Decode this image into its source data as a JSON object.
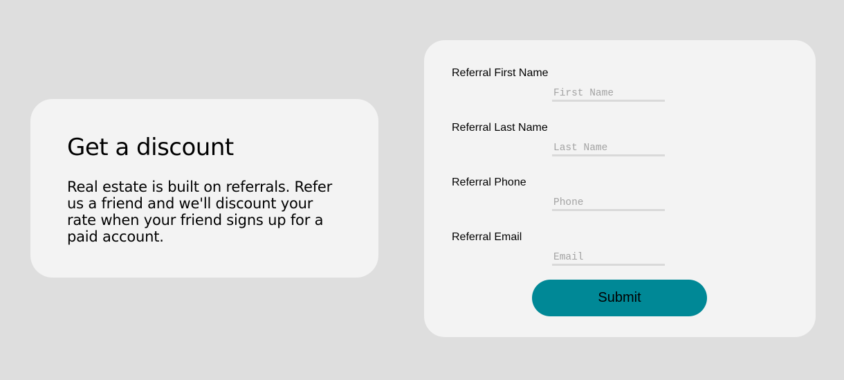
{
  "info": {
    "title": "Get a discount",
    "body": "Real estate is built on referrals. Refer us a friend and we'll discount your rate when your friend signs up for a paid account."
  },
  "form": {
    "first_name": {
      "label": "Referral First Name",
      "placeholder": "First Name",
      "value": ""
    },
    "last_name": {
      "label": "Referral Last Name",
      "placeholder": "Last Name",
      "value": ""
    },
    "phone": {
      "label": "Referral Phone",
      "placeholder": "Phone",
      "value": ""
    },
    "email": {
      "label": "Referral Email",
      "placeholder": "Email",
      "value": ""
    },
    "submit_label": "Submit"
  },
  "colors": {
    "page_background": "#dedede",
    "card_background": "#f3f3f3",
    "accent": "#008896",
    "input_underline": "#d9d9d9",
    "placeholder_text": "#a3a3a3"
  }
}
